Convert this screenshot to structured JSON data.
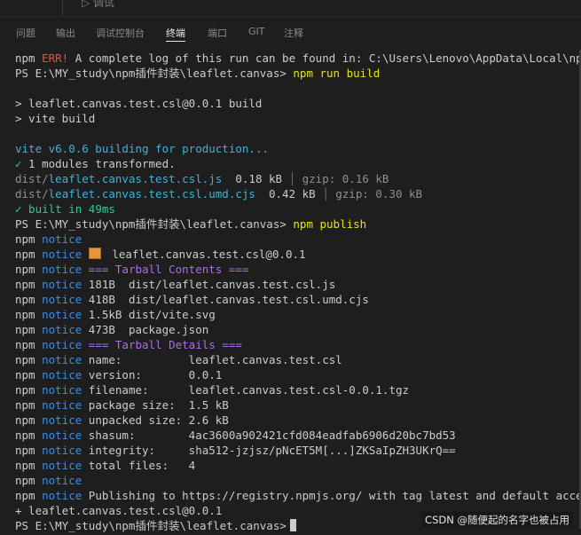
{
  "top": {
    "ghost_text": "▷ 调试"
  },
  "tabs": [
    {
      "label": "问题"
    },
    {
      "label": "输出"
    },
    {
      "label": "调试控制台"
    },
    {
      "label": "终端"
    },
    {
      "label": "端口"
    },
    {
      "label": "GIT"
    },
    {
      "label": "注释"
    }
  ],
  "terminal": {
    "npm": "npm",
    "notice": "notice",
    "err_line": {
      "prefix": "npm ",
      "err": "ERR!",
      "text": " A complete log of this run can be found in: C:\\Users\\Lenovo\\AppData\\Local\\npm-cach"
    },
    "prompt1": {
      "ps": "PS E:\\MY_study\\npm插件封装\\leaflet.canvas> ",
      "cmd": "npm run build"
    },
    "build_l1": "> leaflet.canvas.test.csl@0.0.1 build",
    "build_l2": "> vite build",
    "vite_line": "vite v6.0.6 building for production...",
    "transformed": {
      "check": "✓",
      "text": " 1 modules transformed."
    },
    "file1": {
      "dir": "dist/",
      "name": "leaflet.canvas.test.csl.js",
      "size": "  0.18 kB",
      "sep": " │ ",
      "gzip": "gzip: 0.16 kB"
    },
    "file2": {
      "dir": "dist/",
      "name": "leaflet.canvas.test.csl.umd.cjs",
      "size": "  0.42 kB",
      "sep": " │ ",
      "gzip": "gzip: 0.30 kB"
    },
    "built": {
      "check": "✓",
      "text": " built in 49ms"
    },
    "prompt2": {
      "ps": "PS E:\\MY_study\\npm插件封装\\leaflet.canvas> ",
      "cmd": "npm publish"
    },
    "pkg_line": "leaflet.canvas.test.csl@0.0.1",
    "tarball_contents": "=== Tarball Contents ===",
    "contents": [
      "181B  dist/leaflet.canvas.test.csl.js",
      "418B  dist/leaflet.canvas.test.csl.umd.cjs",
      "1.5kB dist/vite.svg",
      "473B  package.json"
    ],
    "tarball_details": "=== Tarball Details ===",
    "details": [
      "name:          leaflet.canvas.test.csl",
      "version:       0.0.1",
      "filename:      leaflet.canvas.test.csl-0.0.1.tgz",
      "package size:  1.5 kB",
      "unpacked size: 2.6 kB",
      "shasum:        4ac3600a902421cfd084eadfab6906d20bc7bd53",
      "integrity:     sha512-jzjsz/pNcET5M[...]ZKSaIpZH3UKrQ==",
      "total files:   4"
    ],
    "publishing": "Publishing to https://registry.npmjs.org/ with tag latest and default access",
    "published": "+ leaflet.canvas.test.csl@0.0.1",
    "prompt3": {
      "ps": "PS E:\\MY_study\\npm插件封装\\leaflet.canvas>"
    }
  },
  "watermark": "CSDN @随便起的名字也被占用"
}
